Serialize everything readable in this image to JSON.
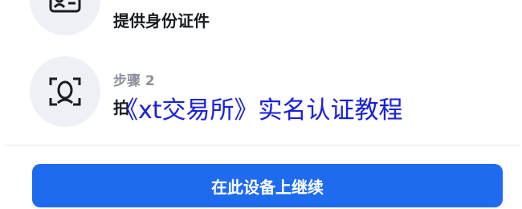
{
  "steps": [
    {
      "label": "",
      "title": "提供身份证件",
      "icon": "id-card-icon"
    },
    {
      "label": "步骤 2",
      "title": "拍",
      "icon": "face-scan-icon"
    }
  ],
  "overlay": {
    "text": "《xt交易所》实名认证教程"
  },
  "actions": {
    "continue_label": "在此设备上继续"
  },
  "colors": {
    "primary": "#1f6bf0",
    "icon_bg": "#eef0f6",
    "watermark": "#1c23d6"
  }
}
